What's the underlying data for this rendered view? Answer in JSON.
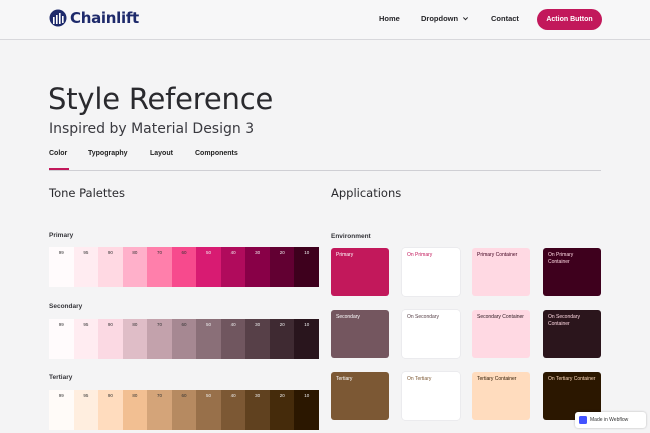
{
  "brand": {
    "name": "Chainlift",
    "color": "#1e2a6b"
  },
  "nav": {
    "home": "Home",
    "dropdown": "Dropdown",
    "contact": "Contact",
    "action_button": "Action Button",
    "accent": "#c2185b"
  },
  "page": {
    "title": "Style Reference",
    "subtitle": "Inspired by Material Design 3"
  },
  "tabs": [
    {
      "label": "Color",
      "active": true
    },
    {
      "label": "Typography",
      "active": false
    },
    {
      "label": "Layout",
      "active": false
    },
    {
      "label": "Components",
      "active": false
    }
  ],
  "tone_palettes": {
    "heading": "Tone Palettes",
    "tones": [
      "99",
      "95",
      "90",
      "80",
      "70",
      "60",
      "50",
      "40",
      "30",
      "20",
      "10"
    ],
    "palettes": [
      {
        "name": "Primary",
        "colors": [
          "#fffbfc",
          "#ffecf1",
          "#ffd9e3",
          "#ffb0ca",
          "#ff7fab",
          "#f74a8d",
          "#d81b72",
          "#b00b5c",
          "#880047",
          "#620032",
          "#3e001d"
        ]
      },
      {
        "name": "Secondary",
        "colors": [
          "#fffbfc",
          "#ffecf1",
          "#fbd9e3",
          "#dfbdc7",
          "#c3a2ac",
          "#a68892",
          "#8a6f78",
          "#70565f",
          "#574048",
          "#3f2a32",
          "#29151d"
        ]
      },
      {
        "name": "Tertiary",
        "colors": [
          "#fffbf8",
          "#ffeedf",
          "#ffdcbe",
          "#f2bf92",
          "#d4a479",
          "#b68a61",
          "#98704a",
          "#7c5834",
          "#60411f",
          "#452b0b",
          "#2b1700"
        ]
      }
    ]
  },
  "applications": {
    "heading": "Applications",
    "environment_label": "Environment",
    "cards": [
      {
        "label": "Primary",
        "bg": "#c2185b",
        "fg": "#ffffff"
      },
      {
        "label": "On Primary",
        "bg": "#ffffff",
        "fg": "#c2185b"
      },
      {
        "label": "Primary Container",
        "bg": "#ffd9e3",
        "fg": "#3e001d"
      },
      {
        "label": "On Primary Container",
        "bg": "#3e001d",
        "fg": "#ffd9e3"
      },
      {
        "label": "Secondary",
        "bg": "#74565f",
        "fg": "#ffffff"
      },
      {
        "label": "On Secondary",
        "bg": "#ffffff",
        "fg": "#574048"
      },
      {
        "label": "Secondary Container",
        "bg": "#ffd9e3",
        "fg": "#29151d"
      },
      {
        "label": "On Secondary Container",
        "bg": "#2b151c",
        "fg": "#ffd9e3"
      },
      {
        "label": "Tertiary",
        "bg": "#7c5834",
        "fg": "#ffffff"
      },
      {
        "label": "On Tertiary",
        "bg": "#ffffff",
        "fg": "#7c5834"
      },
      {
        "label": "Tertiary Container",
        "bg": "#ffdcbe",
        "fg": "#2b1700"
      },
      {
        "label": "On Tertiary Container",
        "bg": "#2b1700",
        "fg": "#ffdcbe"
      }
    ]
  },
  "badge": {
    "text": "Made in Webflow"
  }
}
